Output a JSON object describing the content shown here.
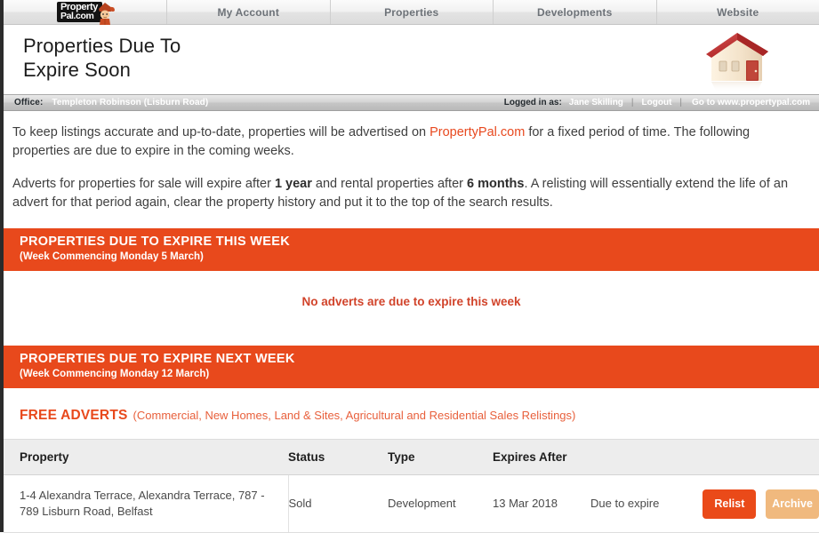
{
  "nav": {
    "logo": {
      "line1": "Property",
      "line2": "Pal.com",
      "mascot_icon": "mascot-icon"
    },
    "tabs": [
      {
        "label": "My Account"
      },
      {
        "label": "Properties"
      },
      {
        "label": "Developments"
      },
      {
        "label": "Website"
      }
    ]
  },
  "header": {
    "title_line1": "Properties Due To",
    "title_line2": "Expire Soon",
    "house_icon": "house-icon"
  },
  "officebar": {
    "office_label": "Office:",
    "office_name": "Templeton Robinson (Lisburn Road)",
    "logged_in_label": "Logged in as:",
    "user_name": "Jane Skilling",
    "separator": "|",
    "logout_label": "Logout",
    "site_link_label": "Go to www.propertypal.com"
  },
  "intro": {
    "p1_before": "To keep listings accurate and up-to-date, properties will be advertised on ",
    "p1_brand": "PropertyPal.com",
    "p1_after": " for a fixed period of time. The following properties are due to expire in the coming weeks.",
    "p2_a": "Adverts for properties for sale will expire after ",
    "p2_b": "1 year",
    "p2_c": " and rental properties after ",
    "p2_d": "6 months",
    "p2_e": ". A relisting will essentially extend the life of an advert for that period again, clear the property history and put it to the top of the search results."
  },
  "this_week": {
    "title": "PROPERTIES DUE TO EXPIRE THIS WEEK",
    "subtitle": "(Week Commencing Monday 5 March)",
    "empty_message": "No adverts are due to expire this week"
  },
  "next_week": {
    "title": "PROPERTIES DUE TO EXPIRE NEXT WEEK",
    "subtitle": "(Week Commencing Monday 12 March)"
  },
  "free_adverts": {
    "title": "FREE ADVERTS",
    "subtitle": "(Commercial, New Homes, Land & Sites, Agricultural and Residential Sales Relistings)"
  },
  "table": {
    "columns": [
      "Property",
      "Status",
      "Type",
      "Expires After"
    ],
    "rows": [
      {
        "property": "1-4 Alexandra Terrace, Alexandra Terrace, 787 - 789 Lisburn Road, Belfast",
        "status": "Sold",
        "type": "Development",
        "expires_after": "13 Mar 2018",
        "state": "Due to expire",
        "relist_label": "Relist",
        "archive_label": "Archive"
      }
    ]
  },
  "colors": {
    "brand_orange": "#e8491c",
    "relist_button": "#ea4a19",
    "archive_button": "#f0b97e",
    "empty_note": "#d1432a"
  }
}
